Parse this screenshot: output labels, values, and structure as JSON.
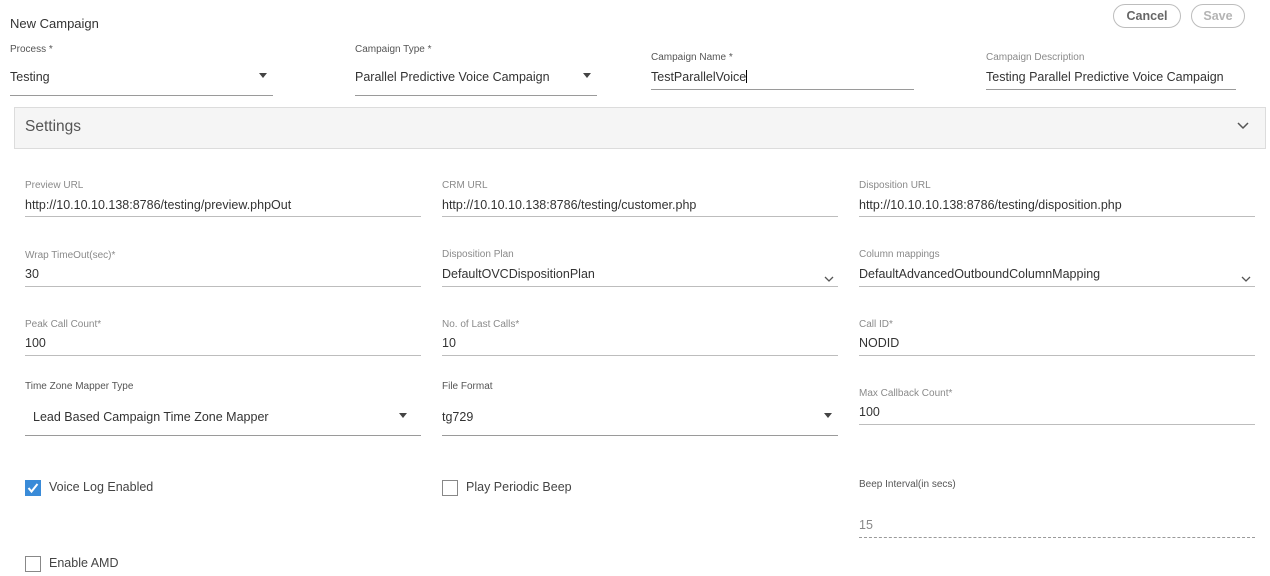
{
  "header": {
    "title": "New Campaign",
    "cancel_label": "Cancel",
    "save_label": "Save"
  },
  "top_fields": {
    "process": {
      "label": "Process *",
      "value": "Testing"
    },
    "campaign_type": {
      "label": "Campaign Type *",
      "value": "Parallel Predictive Voice Campaign"
    },
    "campaign_name": {
      "label": "Campaign Name *",
      "value": "TestParallelVoice"
    },
    "campaign_description": {
      "label": "Campaign Description",
      "value": "Testing Parallel Predictive Voice Campaign"
    }
  },
  "settings": {
    "title": "Settings",
    "preview_url": {
      "label": "Preview URL",
      "value": "http://10.10.10.138:8786/testing/preview.phpOut"
    },
    "crm_url": {
      "label": "CRM URL",
      "value": "http://10.10.10.138:8786/testing/customer.php"
    },
    "disposition_url": {
      "label": "Disposition URL",
      "value": "http://10.10.10.138:8786/testing/disposition.php"
    },
    "wrap_timeout": {
      "label": "Wrap TimeOut(sec)*",
      "value": "30"
    },
    "disposition_plan": {
      "label": "Disposition Plan",
      "value": "DefaultOVCDispositionPlan"
    },
    "column_mappings": {
      "label": "Column mappings",
      "value": "DefaultAdvancedOutboundColumnMapping"
    },
    "peak_call_count": {
      "label": "Peak Call Count*",
      "value": "100"
    },
    "last_calls": {
      "label": "No. of Last Calls*",
      "value": "10"
    },
    "call_id": {
      "label": "Call ID*",
      "value": "NODID"
    },
    "time_zone_mapper": {
      "label": "Time Zone Mapper Type",
      "value": "Lead Based Campaign Time Zone Mapper"
    },
    "file_format": {
      "label": "File Format",
      "value": "tg729"
    },
    "max_callback": {
      "label": "Max Callback Count*",
      "value": "100"
    },
    "voice_log": {
      "label": "Voice Log Enabled",
      "checked": true
    },
    "periodic_beep": {
      "label": "Play Periodic Beep",
      "checked": false
    },
    "beep_interval": {
      "label": "Beep Interval(in secs)",
      "value": "15"
    },
    "enable_amd": {
      "label": "Enable AMD",
      "checked": false
    }
  },
  "colors": {
    "accent": "#3a8bd8",
    "panel": "#f5f5f5"
  }
}
